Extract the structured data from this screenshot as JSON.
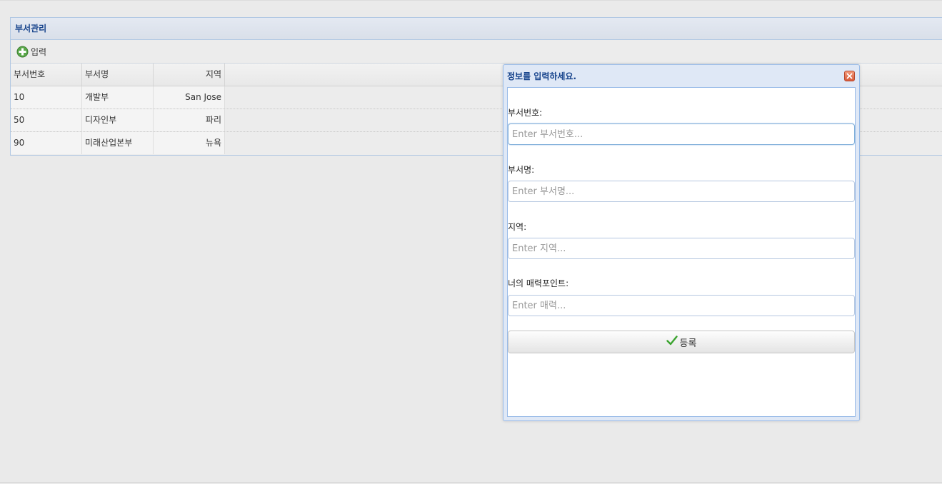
{
  "panel": {
    "title": "부서관리",
    "toolbar": {
      "add_label": "입력",
      "add_icon": "plus-circle-icon"
    },
    "columns": [
      "부서번호",
      "부서명",
      "지역"
    ],
    "rows": [
      {
        "deptno": "10",
        "dname": "개발부",
        "loc": "San Jose"
      },
      {
        "deptno": "50",
        "dname": "디자인부",
        "loc": "파리"
      },
      {
        "deptno": "90",
        "dname": "미래산업본부",
        "loc": "뉴욕"
      }
    ]
  },
  "dialog": {
    "title": "정보를 입력하세요.",
    "close_icon": "close-icon",
    "fields": [
      {
        "label": "부서번호:",
        "placeholder": "Enter 부서번호...",
        "value": ""
      },
      {
        "label": "부서명:",
        "placeholder": "Enter 부서명...",
        "value": ""
      },
      {
        "label": "지역:",
        "placeholder": "Enter 지역...",
        "value": ""
      },
      {
        "label": "너의 매력포인트:",
        "placeholder": "Enter 매력...",
        "value": ""
      }
    ],
    "submit_label": "등록",
    "submit_icon": "checkmark-icon"
  },
  "colors": {
    "header_text": "#15428b",
    "border_blue": "#99bbe8",
    "add_icon_green": "#4a9a3a",
    "check_green": "#3aa32e",
    "close_red": "#d85a3a"
  }
}
